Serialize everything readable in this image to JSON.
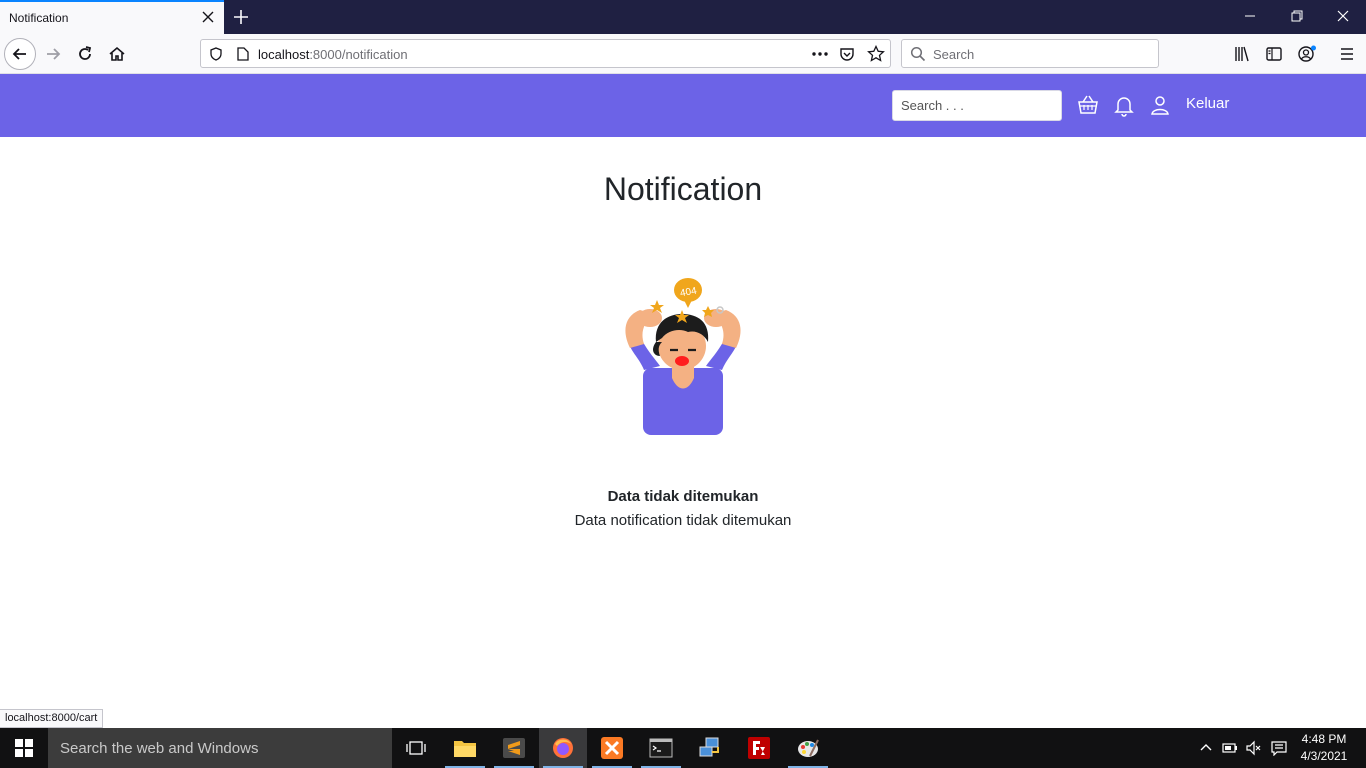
{
  "browser": {
    "tab_title": "Notification",
    "url_host": "localhost",
    "url_rest": ":8000/notification",
    "search_placeholder": "Search",
    "status_url": "localhost:8000/cart"
  },
  "app": {
    "search_placeholder": "Search . . .",
    "logout_label": "Keluar",
    "page_title": "Notification",
    "illustration_badge": "404",
    "empty_title": "Data tidak ditemukan",
    "empty_desc": "Data notification tidak ditemukan",
    "colors": {
      "header": "#6c63e7",
      "accent": "#f0a61c"
    }
  },
  "taskbar": {
    "search_placeholder": "Search the web and Windows",
    "time": "4:48 PM",
    "date": "4/3/2021"
  }
}
